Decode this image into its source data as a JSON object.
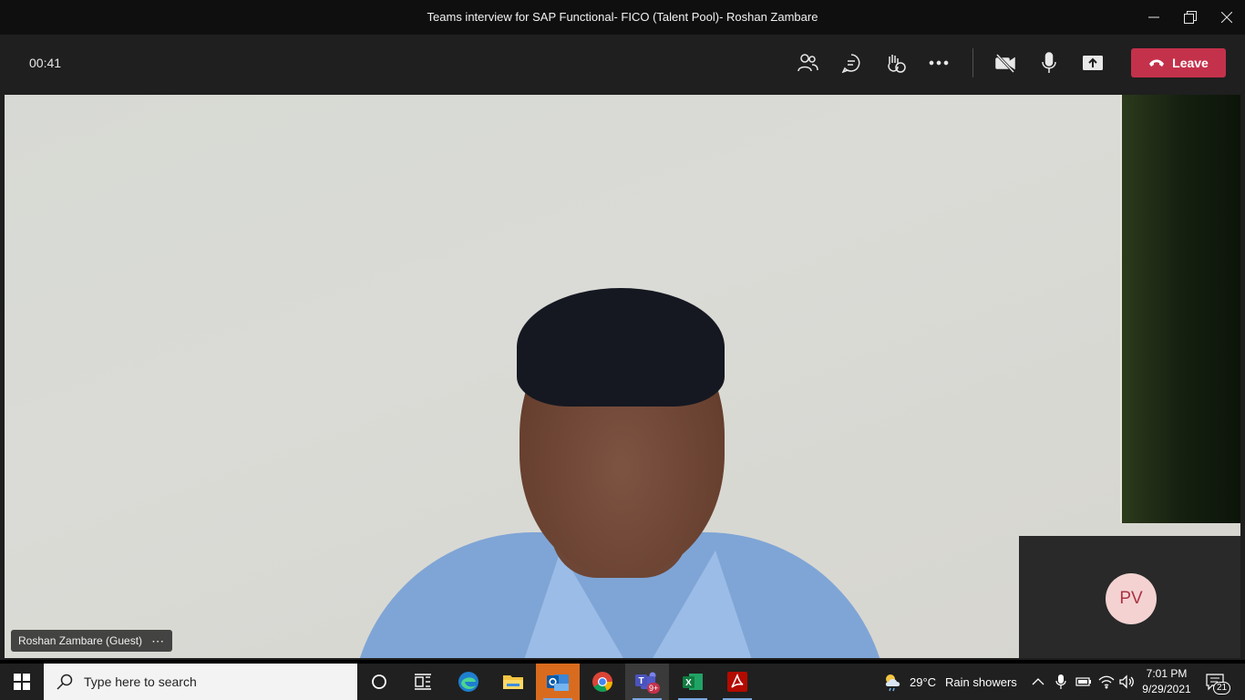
{
  "window": {
    "title": "Teams interview for SAP Functional- FICO (Talent Pool)- Roshan Zambare"
  },
  "toolbar": {
    "timer": "00:41",
    "leave_label": "Leave"
  },
  "video": {
    "participant_name": "Roshan Zambare (Guest)",
    "more_label": "⋯"
  },
  "self_view": {
    "initials": "PV"
  },
  "taskbar": {
    "search_placeholder": "Type here to search",
    "teams_badge": "9+",
    "weather_temp": "29°C",
    "weather_desc": "Rain showers",
    "time": "7:01 PM",
    "date": "9/29/2021",
    "notifications": "21"
  },
  "colors": {
    "leave": "#c4314b",
    "avatar_bg": "#f4d2d2",
    "avatar_text": "#aa3344"
  }
}
